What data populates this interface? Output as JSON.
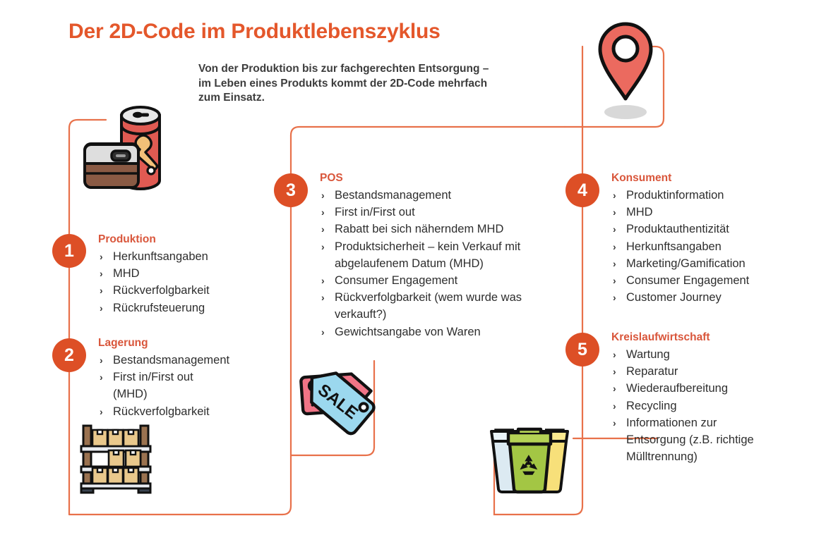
{
  "header": {
    "title": "Der 2D-Code im Produktlebenszyklus",
    "subtitle": "Von der Produktion bis zur fachgerechten Entsorgung – im Leben eines Produkts kommt der 2D-Code mehrfach zum Einsatz."
  },
  "colors": {
    "title_orange": "#E4572B",
    "badge_orange": "#DD4F26",
    "heading_orange": "#D9563B",
    "connector_orange": "#E8714A",
    "body_text": "#2E2E2E",
    "can_red": "#E05A52",
    "tag_pink": "#F07486",
    "tag_blue": "#9BD8EE",
    "box_tan": "#E9C88C",
    "bin_green": "#A3C council",
    "bin_yellow": "#F7E07A",
    "bin_blue": "#DCEAF2",
    "pin_red": "#EB6A5F",
    "shadow_grey": "#D8D8D8"
  },
  "bullet_glyph": "›",
  "steps": [
    {
      "number": "1",
      "title": "Produktion",
      "items": [
        "Herkunftsangaben",
        "MHD",
        "Rückverfolgbarkeit",
        "Rückrufsteuerung"
      ]
    },
    {
      "number": "2",
      "title": "Lagerung",
      "items": [
        "Bestandsmanagement",
        "First in/First out (MHD)",
        "Rückverfolgbarkeit"
      ]
    },
    {
      "number": "3",
      "title": "POS",
      "items": [
        "Bestandsmanagement",
        "First in/First out",
        "Rabatt bei sich näherndem MHD",
        "Produktsicherheit – kein Verkauf mit abgelaufenem Datum (MHD)",
        "Consumer Engagement",
        "Rückverfolgbarkeit (wem wurde was verkauft?)",
        "Gewichtsangabe von Waren"
      ]
    },
    {
      "number": "4",
      "title": "Konsument",
      "items": [
        "Produktinformation",
        "MHD",
        "Produktauthentizität",
        "Herkunftsangaben",
        "Marketing/Gamification",
        "Consumer Engagement",
        "Customer Journey"
      ]
    },
    {
      "number": "5",
      "title": "Kreislaufwirtschaft",
      "items": [
        "Wartung",
        "Reparatur",
        "Wiederaufbereitung",
        "Recycling",
        "Informationen zur Entsorgung (z.B. richtige Mülltrennung)"
      ]
    }
  ],
  "icons": [
    {
      "name": "canned-food-icon",
      "label": "Konservendose mit Hähnchenkeule"
    },
    {
      "name": "map-pin-icon",
      "label": "Standort-Markierung"
    },
    {
      "name": "warehouse-shelf-icon",
      "label": "Lagerregal mit Kartons"
    },
    {
      "name": "sale-tag-icon",
      "label": "Rabatt- und SALE-Anhänger"
    },
    {
      "name": "recycling-bins-icon",
      "label": "Drei Mülltonnen zur Trennung"
    }
  ],
  "sale_tag": {
    "percent_symbol": "%",
    "sale_text": "SALE"
  }
}
